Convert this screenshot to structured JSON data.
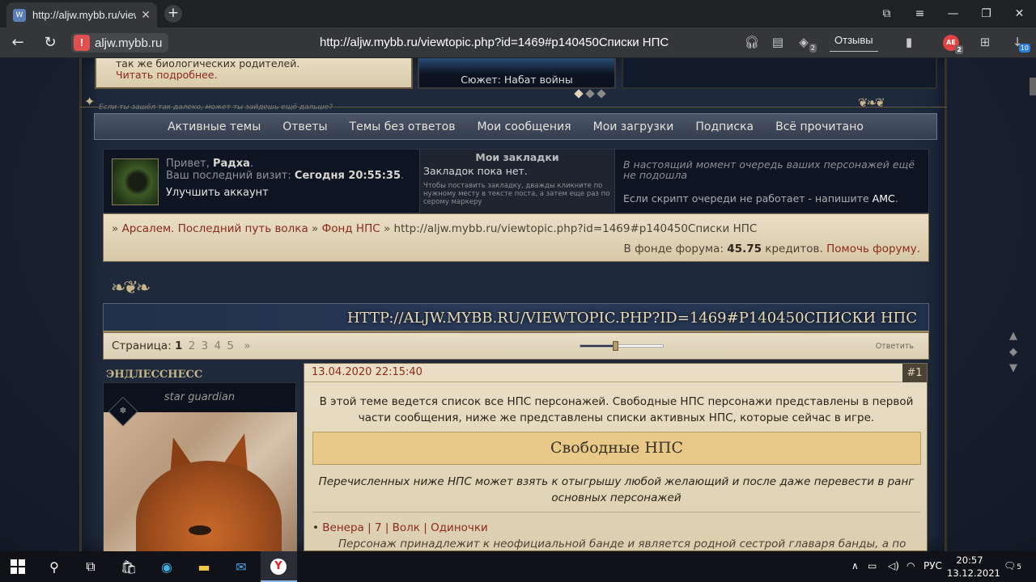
{
  "browser": {
    "tab_title": "http://aljw.mybb.ru/viewt",
    "tab_close": "✕",
    "new_tab": "+",
    "site": "aljw.mybb.ru",
    "url": "http://aljw.mybb.ru/viewtopic.php?id=1469#p140450Списки НПС",
    "reviews_label": "Отзывы",
    "badge_ext": "2",
    "badge_profile": "АЕ",
    "badge_profile_count": "2",
    "badge_downloads": "10"
  },
  "top_strip": {
    "announce_text": "так же биологических родителей.",
    "announce_link": "Читать подробнее.",
    "plot_caption": "Сюжет: Набат войны",
    "tagline": "Если ты зашёл так далеко, может ты зайдешь ещё дальше?"
  },
  "nav": {
    "items": [
      "Активные темы",
      "Ответы",
      "Темы без ответов",
      "Мои сообщения",
      "Мои загрузки",
      "Подписка",
      "Всё прочитано"
    ]
  },
  "user": {
    "greeting_prefix": "Привет, ",
    "name": "Радха",
    "greeting_suffix": ".",
    "last_visit_label": "Ваш последний визит: ",
    "last_visit_value": "Сегодня 20:55:35",
    "last_visit_suffix": ".",
    "upgrade": "Улучшить аккаунт"
  },
  "bookmarks": {
    "title": "Мои закладки",
    "empty": "Закладок пока нет.",
    "hint": "Чтобы поставить закладку, дважды кликните по нужному месту в тексте поста, а затем еще раз по серому маркеру"
  },
  "queue": {
    "status": "В настоящий момент очередь ваших персонажей ещё не подошла",
    "fallback_prefix": "Если скрипт очереди не работает - напишите ",
    "fallback_link": "АМС",
    "fallback_suffix": "."
  },
  "breadcrumb": {
    "sep": "»",
    "items": [
      "Арсалем. Последний путь волка",
      "Фонд НПС"
    ],
    "current": "http://aljw.mybb.ru/viewtopic.php?id=1469#p140450Списки НПС"
  },
  "fund": {
    "label": "В фонде форума: ",
    "value": "45.75",
    "unit": " кредитов. ",
    "link": "Помочь форуму."
  },
  "topic": {
    "title": "HTTP://ALJW.MYBB.RU/VIEWTOPIC.PHP?ID=1469#P140450СПИСКИ НПС",
    "page_label": "Страница: ",
    "current_page": "1",
    "pages": [
      "2",
      "3",
      "4",
      "5"
    ],
    "next": "»",
    "reply": "Ответить"
  },
  "post": {
    "author": "ЭНДЛЕССНЕСС",
    "author_title": "star guardian",
    "date": "13.04.2020 22:15:40",
    "number": "#1",
    "intro": "В этой теме ведется список все НПС персонажей. Свободные НПС персонажи представлены в первой части сообщения, ниже же представлены списки активных НПС, которые сейчас в игре.",
    "section_title": "Свободные НПС",
    "section_note": "Перечисленных ниже НПС может взять к отыгрышу любой желающий и после даже перевести в ранг основных персонажей",
    "npc_bullet": "•",
    "npc_line": "Венера | 7 | Волк | Одиночки",
    "npc_desc": "Персонаж принадлежит к неофициальной банде и является родной сестрой главаря банды, а по"
  },
  "taskbar": {
    "lang": "РУС",
    "time": "20:57",
    "date": "13.12.2021",
    "notif_count": "5"
  }
}
